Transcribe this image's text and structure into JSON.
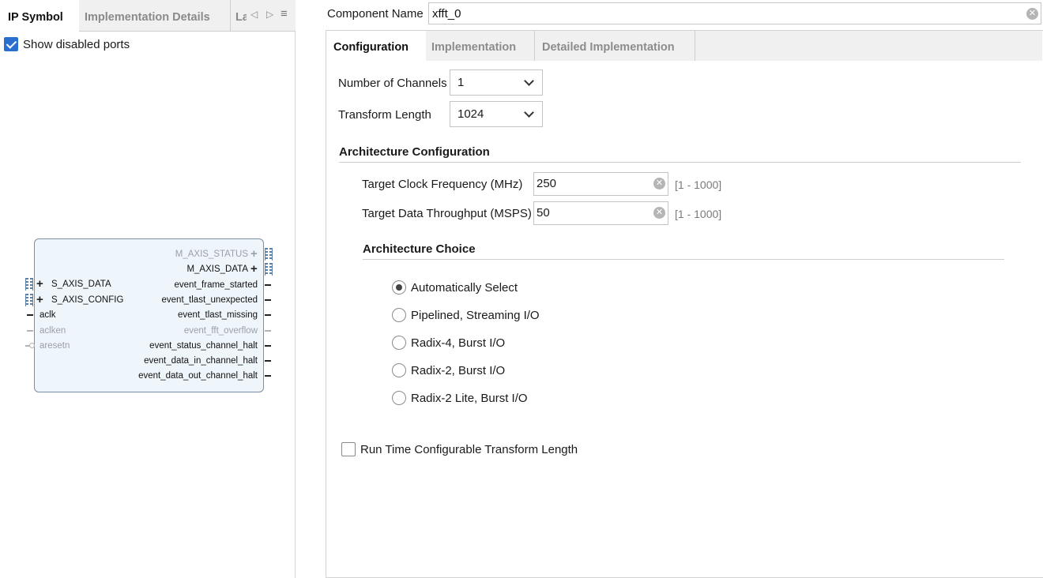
{
  "left_panel": {
    "tabs": [
      "IP Symbol",
      "Implementation Details",
      "La"
    ],
    "show_disabled_ports": {
      "label": "Show disabled ports",
      "checked": true
    },
    "ip_symbol": {
      "right_ports": [
        {
          "name": "M_AXIS_STATUS",
          "disabled": true,
          "bus": true
        },
        {
          "name": "M_AXIS_DATA",
          "disabled": false,
          "bus": true
        },
        {
          "name": "event_frame_started",
          "disabled": false,
          "bus": false
        },
        {
          "name": "event_tlast_unexpected",
          "disabled": false,
          "bus": false
        },
        {
          "name": "event_tlast_missing",
          "disabled": false,
          "bus": false
        },
        {
          "name": "event_fft_overflow",
          "disabled": true,
          "bus": false
        },
        {
          "name": "event_status_channel_halt",
          "disabled": false,
          "bus": false
        },
        {
          "name": "event_data_in_channel_halt",
          "disabled": false,
          "bus": false
        },
        {
          "name": "event_data_out_channel_halt",
          "disabled": false,
          "bus": false
        }
      ],
      "left_ports": [
        {
          "name": "S_AXIS_DATA",
          "disabled": false,
          "bus": true
        },
        {
          "name": "S_AXIS_CONFIG",
          "disabled": false,
          "bus": true
        },
        {
          "name": "aclk",
          "disabled": false,
          "bus": false
        },
        {
          "name": "aclken",
          "disabled": true,
          "bus": false
        },
        {
          "name": "aresetn",
          "disabled": true,
          "bus": false
        }
      ]
    }
  },
  "component": {
    "label": "Component Name",
    "value": "xfft_0"
  },
  "config_tabs": [
    "Configuration",
    "Implementation",
    "Detailed Implementation"
  ],
  "configuration": {
    "channels": {
      "label": "Number of Channels",
      "value": "1"
    },
    "transform_length": {
      "label": "Transform Length",
      "value": "1024"
    },
    "arch_config_title": "Architecture Configuration",
    "clock_freq": {
      "label": "Target Clock Frequency (MHz)",
      "value": "250",
      "range": "[1 - 1000]"
    },
    "throughput": {
      "label": "Target Data Throughput (MSPS)",
      "value": "50",
      "range": "[1 - 1000]"
    },
    "arch_choice_title": "Architecture Choice",
    "arch_options": [
      {
        "label": "Automatically Select",
        "selected": true
      },
      {
        "label": "Pipelined, Streaming I/O",
        "selected": false
      },
      {
        "label": "Radix-4, Burst I/O",
        "selected": false
      },
      {
        "label": "Radix-2, Burst I/O",
        "selected": false
      },
      {
        "label": "Radix-2 Lite, Burst I/O",
        "selected": false
      }
    ],
    "runtime_config": {
      "label": "Run Time Configurable Transform Length",
      "checked": false
    }
  },
  "colors": {
    "accent": "#2a6fd0",
    "block_fill": "#eef5fb",
    "block_border": "#7c8ea5",
    "disabled_text": "#9aa0a6"
  },
  "icons": [
    "chevron-left-icon",
    "chevron-right-icon",
    "tab-menu-icon",
    "clear-icon",
    "chevron-down-icon",
    "plus-icon",
    "bus-icon"
  ]
}
